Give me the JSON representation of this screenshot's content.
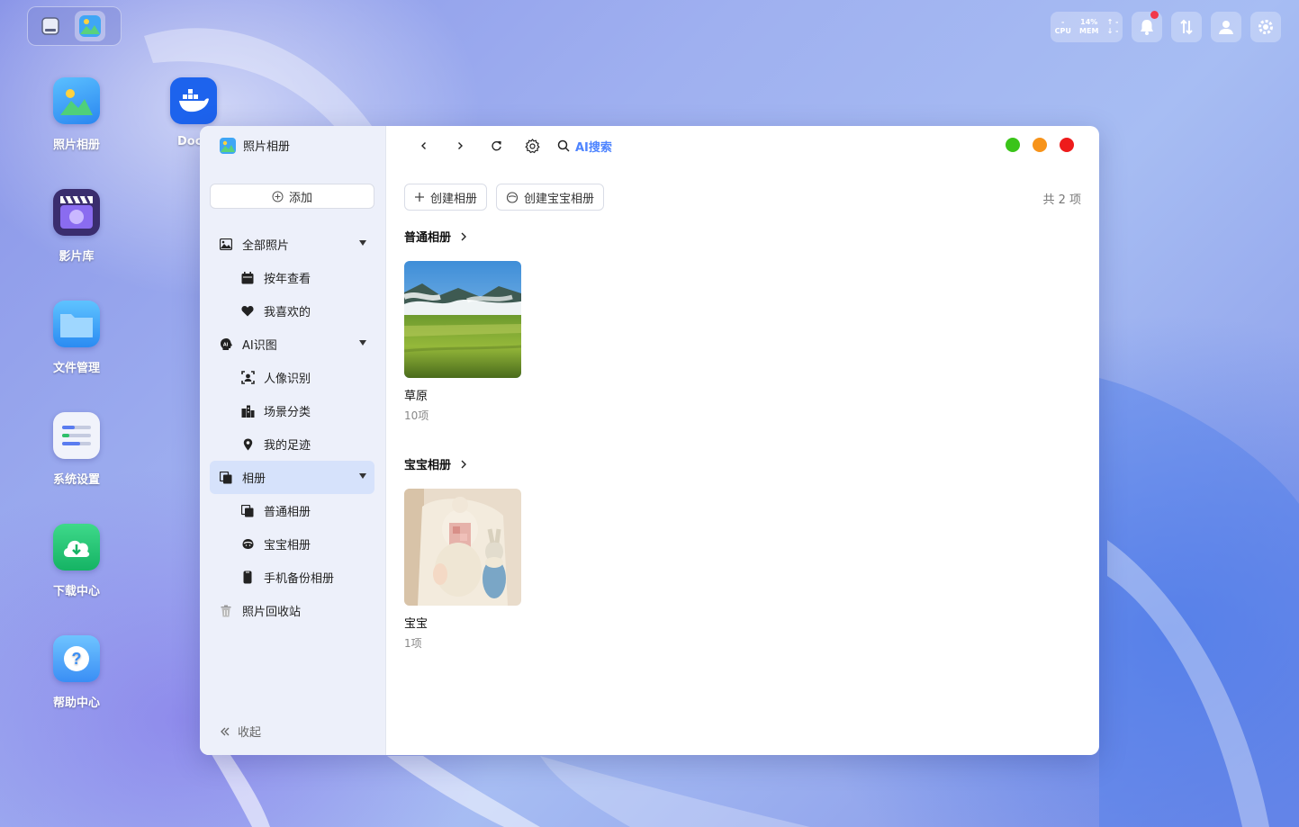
{
  "desktop": {
    "icons": [
      {
        "label": "照片相册",
        "icon": "photos-icon"
      },
      {
        "label": "影片库",
        "icon": "video-library-icon"
      },
      {
        "label": "文件管理",
        "icon": "folder-icon"
      },
      {
        "label": "系统设置",
        "icon": "settings-sliders-icon"
      },
      {
        "label": "下载中心",
        "icon": "download-cloud-icon"
      },
      {
        "label": "帮助中心",
        "icon": "help-icon"
      }
    ],
    "docker_label": "Dock"
  },
  "tray": {
    "cpu_value": "-",
    "cpu_label": "CPU",
    "mem_value": "14%",
    "mem_label": "MEM",
    "net_up": "↑ -",
    "net_down": "↓ -"
  },
  "window": {
    "app_title": "照片相册",
    "add_label": "添加",
    "nav": {
      "all_photos": "全部照片",
      "by_year": "按年查看",
      "favorites": "我喜欢的",
      "ai_recognition": "AI识图",
      "faces": "人像识别",
      "scenes": "场景分类",
      "footprints": "我的足迹",
      "albums": "相册",
      "normal_albums": "普通相册",
      "baby_albums": "宝宝相册",
      "phone_backup": "手机备份相册",
      "recycle_bin": "照片回收站"
    },
    "collapse_label": "收起",
    "toolbar": {
      "ai_search": "AI搜索"
    },
    "traffic_colors": {
      "green": "#3ac419",
      "orange": "#f7931a",
      "red": "#ee1b1b"
    },
    "actions": {
      "create_album": "创建相册",
      "create_baby_album": "创建宝宝相册"
    },
    "total_count": "共 2 项",
    "sections": {
      "normal": {
        "title": "普通相册",
        "album_name": "草原",
        "album_count": "10项"
      },
      "baby": {
        "title": "宝宝相册",
        "album_name": "宝宝",
        "album_count": "1项"
      }
    }
  }
}
